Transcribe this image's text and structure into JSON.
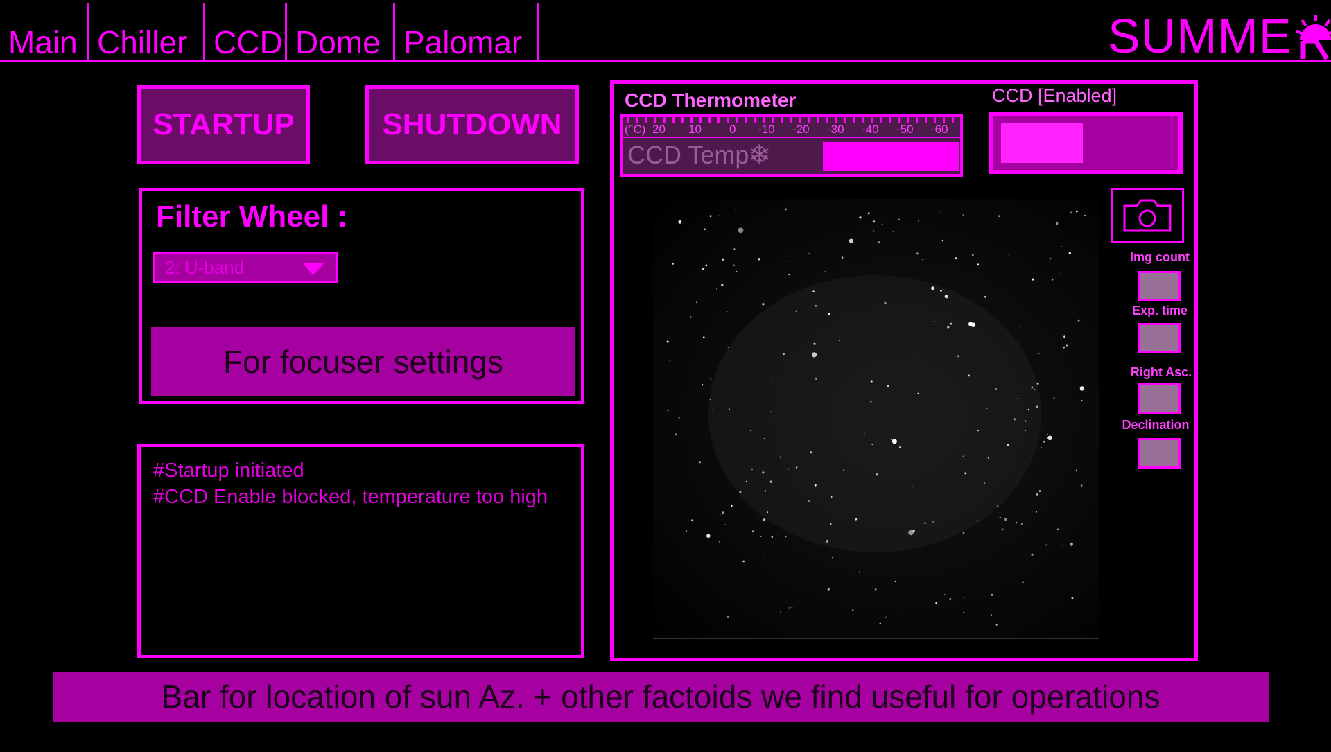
{
  "tabs": [
    "Main",
    "Chiller",
    "CCD",
    "Dome",
    "Palomar"
  ],
  "logo": {
    "text": "SUMME",
    "icon": "sun-r-logo-icon"
  },
  "controls": {
    "startup_label": "STARTUP",
    "shutdown_label": "SHUTDOWN"
  },
  "filter_wheel": {
    "title": "Filter Wheel :",
    "selected": "2: U-band",
    "focuser_button": "For focuser settings"
  },
  "log": {
    "lines": [
      "#Startup initiated",
      "#CCD Enable blocked, temperature too high"
    ]
  },
  "thermometer": {
    "title": "CCD Thermometer",
    "unit": "(°C)",
    "scale": [
      "20",
      "10",
      "0",
      "-10",
      "-20",
      "-30",
      "-40",
      "-50",
      "-60"
    ],
    "label": "CCD Temp",
    "icon": "snowflake-icon"
  },
  "ccd": {
    "status_title": "CCD [Enabled]"
  },
  "camera": {
    "icon": "camera-icon",
    "fields": [
      "Img count",
      "Exp. time",
      "Right Asc.",
      "Declination"
    ]
  },
  "bottom_bar": {
    "text": "Bar for location of sun Az. + other factoids we find useful for operations"
  },
  "colors": {
    "accent": "#ff00ff",
    "panel_fill": "#a700a0",
    "button_fill": "#6a0d66",
    "background": "#000000"
  }
}
